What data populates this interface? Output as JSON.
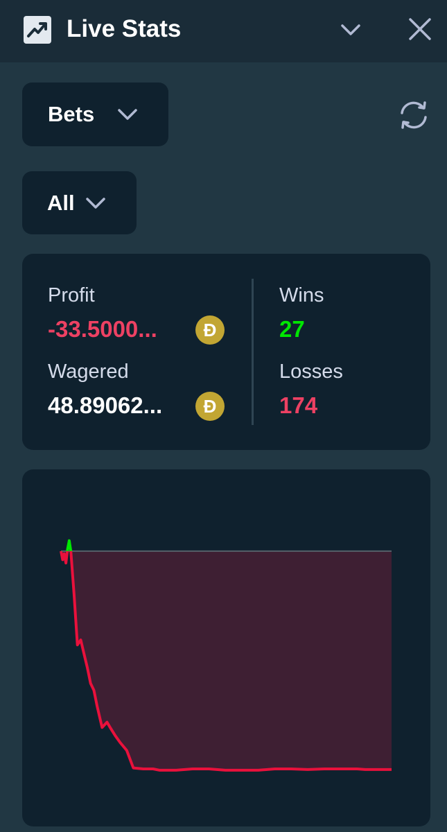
{
  "header": {
    "title": "Live Stats",
    "icon": "trending-chart-icon",
    "collapse_icon": "chevron-down-icon",
    "close_icon": "close-icon"
  },
  "filters": {
    "type_selected": "Bets",
    "range_selected": "All",
    "refresh_icon": "refresh-icon"
  },
  "stats": {
    "profit_label": "Profit",
    "profit_value": "-33.5000...",
    "wagered_label": "Wagered",
    "wagered_value": "48.89062...",
    "currency_symbol": "Ð",
    "wins_label": "Wins",
    "wins_value": "27",
    "losses_label": "Losses",
    "losses_value": "174"
  },
  "colors": {
    "positive": "#00e701",
    "negative": "#ed4163",
    "currency": "#c2a633",
    "chart_loss_line": "#e9113c",
    "chart_loss_fill": "#3e1f33"
  },
  "chart_data": {
    "type": "line",
    "title": "",
    "xlabel": "",
    "ylabel": "",
    "x": [
      0,
      1,
      2,
      3,
      4,
      5,
      6,
      8,
      10,
      12,
      14,
      16,
      18,
      20,
      22,
      25,
      28,
      30,
      33,
      36,
      40,
      44,
      50,
      56,
      60,
      70,
      80,
      90,
      100,
      110,
      120,
      130,
      140,
      150,
      160,
      170,
      175,
      180,
      185,
      190,
      195,
      200,
      201
    ],
    "y": [
      0,
      -2.6,
      -0.8,
      -3.6,
      0.6,
      3.2,
      0,
      -13.5,
      -28.5,
      -27.0,
      -31.2,
      -35.4,
      -40.2,
      -42.3,
      -47.2,
      -53.6,
      -52.0,
      -53.7,
      -56.1,
      -58.2,
      -60.6,
      -65.9,
      -66.2,
      -66.2,
      -66.6,
      -66.6,
      -66.2,
      -66.2,
      -66.6,
      -66.6,
      -66.6,
      -66.2,
      -66.2,
      -66.4,
      -66.2,
      -66.2,
      -66.2,
      -66.2,
      -66.4,
      -66.4,
      -66.4,
      -66.4,
      -66.4
    ],
    "xlim": [
      0,
      201
    ],
    "ylim": [
      -70,
      8
    ],
    "baseline": 0,
    "grid": false,
    "legend": "none"
  }
}
